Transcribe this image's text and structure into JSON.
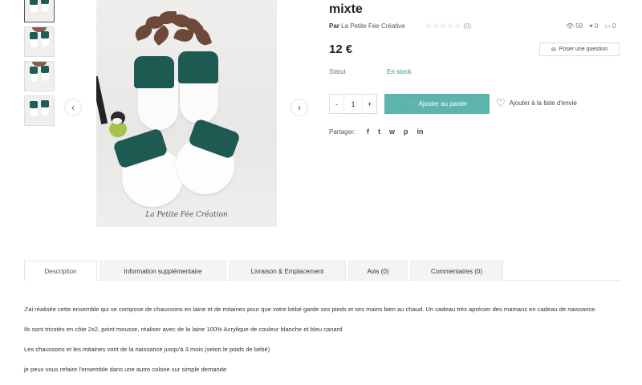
{
  "product": {
    "title": "mixte",
    "by_prefix": "Par",
    "shop_name": "La Petite Fée Créative",
    "rating_stars": "☆☆☆☆☆",
    "rating_count": "(0)",
    "views": "59",
    "likes": "0",
    "comments": "0",
    "price": "12 €",
    "ask_question_label": "Poser une question",
    "status_label": "Statut",
    "status_value": "En stock",
    "quantity": "1",
    "qty_minus": "-",
    "qty_plus": "+",
    "add_to_cart_label": "Ajouter au panier",
    "wishlist_label": "Ajouter à la liste d'envie",
    "share_label": "Partager:",
    "share_icons": [
      "f",
      "t",
      "w",
      "p",
      "in"
    ],
    "image_watermark": "La Petite Fée Création"
  },
  "colors": {
    "accent": "#5cb5ad",
    "in_stock": "#2a9c6e",
    "wool_green": "#1d5a52"
  },
  "gallery": {
    "prev_arrow": "‹",
    "next_arrow": "›"
  },
  "tabs": [
    {
      "label": "Description"
    },
    {
      "label": "Information supplémentaire"
    },
    {
      "label": "Livraison & Emplacement"
    },
    {
      "label": "Avis (0)"
    },
    {
      "label": "Commentaires (0)"
    }
  ],
  "description": {
    "p1": "J'ai réalisée cette ensemble qui se compose de chaussons en laine et de mitaines pour que votre bébé garde ses pieds et ses mains bien au chaud. Un cadeau très aprécier des mamans en cadeau de naissance.",
    "p2": "Ils sont tricotés en côte 2x2, point mousse, réaliser avec de la laine 100% Acrylique de couleur blanche et bleu canard",
    "p3": "Les chaussons et les mitaines vont de la naissance jusqu'à 3 mois (selon le poids de bébé)",
    "p4": "je peux vous refaire l'ensemble dans une autre colorie sur simple demande"
  }
}
